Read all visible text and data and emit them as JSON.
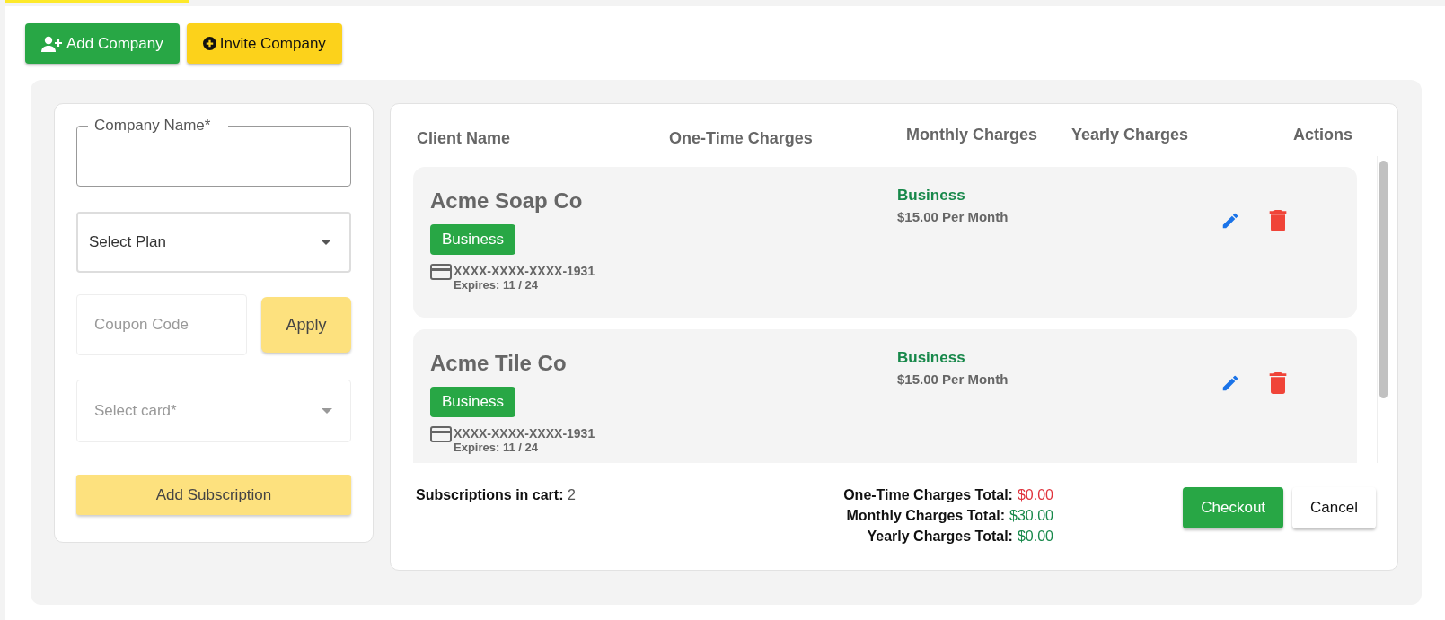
{
  "toolbar": {
    "buttons": [
      {
        "label": "Add Company",
        "kind": "add"
      },
      {
        "label": "Invite Company",
        "kind": "invite"
      }
    ]
  },
  "form": {
    "company_name": {
      "label": "Company Name*"
    },
    "plan_select": {
      "value": "Select Plan"
    },
    "coupon": {
      "placeholder": "Coupon Code"
    },
    "apply_button": {
      "label": "Apply",
      "disabled": true
    },
    "card_select": {
      "placeholder": "Select card*",
      "disabled": true
    },
    "submit_button": {
      "label": "Add Subscription",
      "disabled": true
    }
  },
  "table": {
    "columns": [
      "Client Name",
      "One-Time Charges",
      "Monthly Charges",
      "Yearly Charges",
      "Actions"
    ],
    "rows": [
      {
        "client": "Acme Soap Co",
        "plan_badge": "Business",
        "card": "XXXX-XXXX-XXXX-1931",
        "expires": "Expires: 11 / 24",
        "monthly_plan": "Business",
        "monthly_price": "$15.00 Per Month"
      },
      {
        "client": "Acme Tile Co",
        "plan_badge": "Business",
        "card": "XXXX-XXXX-XXXX-1931",
        "expires": "Expires: 11 / 24",
        "monthly_plan": "Business",
        "monthly_price": "$15.00 Per Month"
      }
    ]
  },
  "footer": {
    "cart_count": "**Subscriptions in cart:** 2",
    "totals": [
      {
        "label": "One-Time Charges Total:",
        "value": "$0.00",
        "color": "#e0323c"
      },
      {
        "label": "Monthly Charges Total:",
        "value": "$30.00",
        "color": "#17884a"
      },
      {
        "label": "Yearly Charges Total:",
        "value": "$0.00",
        "color": "#17884a"
      }
    ],
    "buttons": [
      {
        "label": "Checkout",
        "kind": "primary"
      },
      {
        "label": "Cancel",
        "kind": "secondary"
      }
    ]
  }
}
